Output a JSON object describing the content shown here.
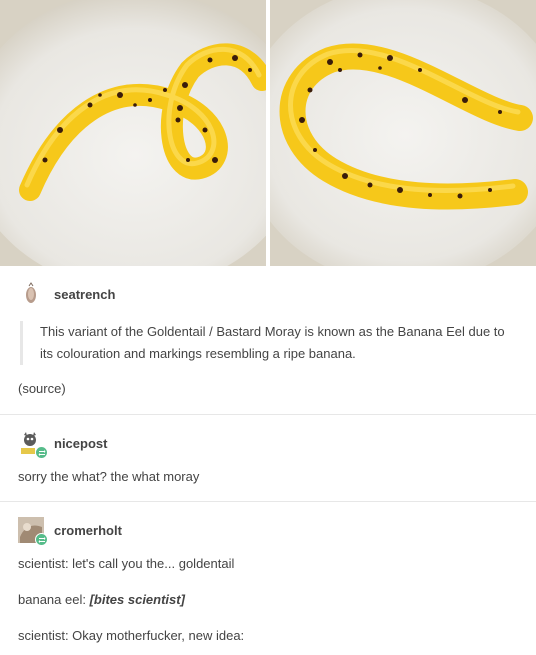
{
  "images": [
    {
      "alt_icon": "banana-eel-photo-1"
    },
    {
      "alt_icon": "banana-eel-photo-2"
    }
  ],
  "post1": {
    "username": "seatrench",
    "quote": "This variant of the Goldentail / Bastard Moray is known as the Banana Eel due to its colouration and markings resembling a ripe banana.",
    "source": "(source)"
  },
  "post2": {
    "username": "nicepost",
    "text": "sorry the what? the what moray"
  },
  "post3": {
    "username": "cromerholt",
    "line1": "scientist: let's call you the... goldentail",
    "line2_prefix": "banana eel: ",
    "line2_action": "[bites scientist]",
    "line3": "scientist: Okay motherfucker, new idea:"
  },
  "colors": {
    "eel_yellow": "#f6c81a",
    "eel_spots": "#3a1c0a",
    "reblog_green": "#56bc8a",
    "divider": "#e7e7e7"
  }
}
